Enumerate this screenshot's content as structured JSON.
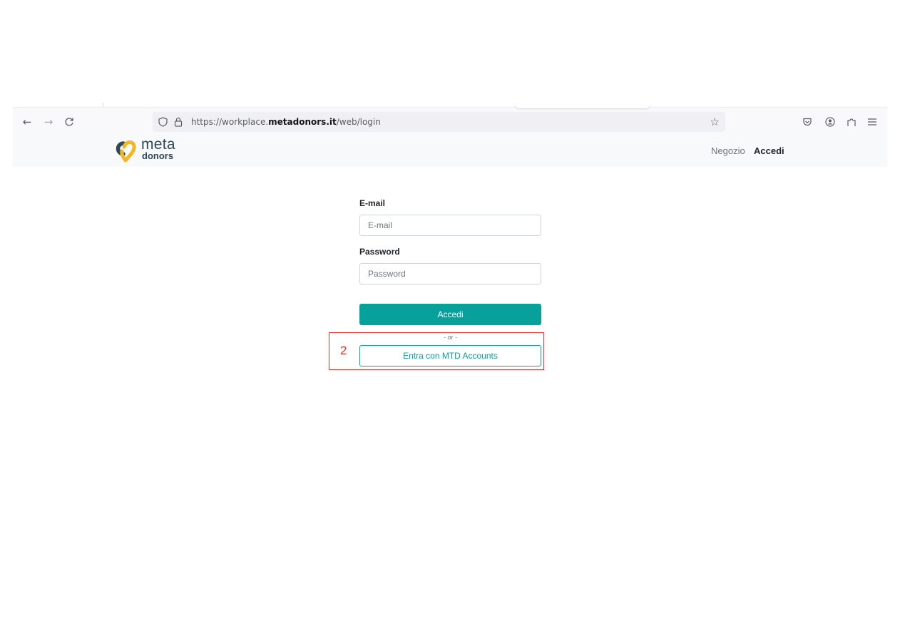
{
  "browser": {
    "url_prefix": "https://workplace.",
    "url_domain": "metadonors.it",
    "url_path": "/web/login",
    "icons": [
      "back-arrow-icon",
      "forward-arrow-icon",
      "reload-icon",
      "shield-icon",
      "lock-icon",
      "bookmark-star-icon",
      "pocket-icon",
      "account-icon",
      "extensions-icon",
      "menu-icon"
    ]
  },
  "header": {
    "logo_word1": "meta",
    "logo_word2": "donors",
    "nav": [
      "Negozio",
      "Accedi"
    ]
  },
  "login": {
    "email_label": "E-mail",
    "email_placeholder": "E-mail",
    "password_label": "Password",
    "password_placeholder": "Password",
    "submit_label": "Accedi",
    "separator": "- or -",
    "oauth_label": "Entra con MTD Accounts"
  },
  "annotation": {
    "number": "2",
    "color": "#e0392b"
  },
  "colors": {
    "primary": "#07a09b",
    "logo_dark": "#2f4858",
    "logo_yellow": "#f2b824"
  }
}
